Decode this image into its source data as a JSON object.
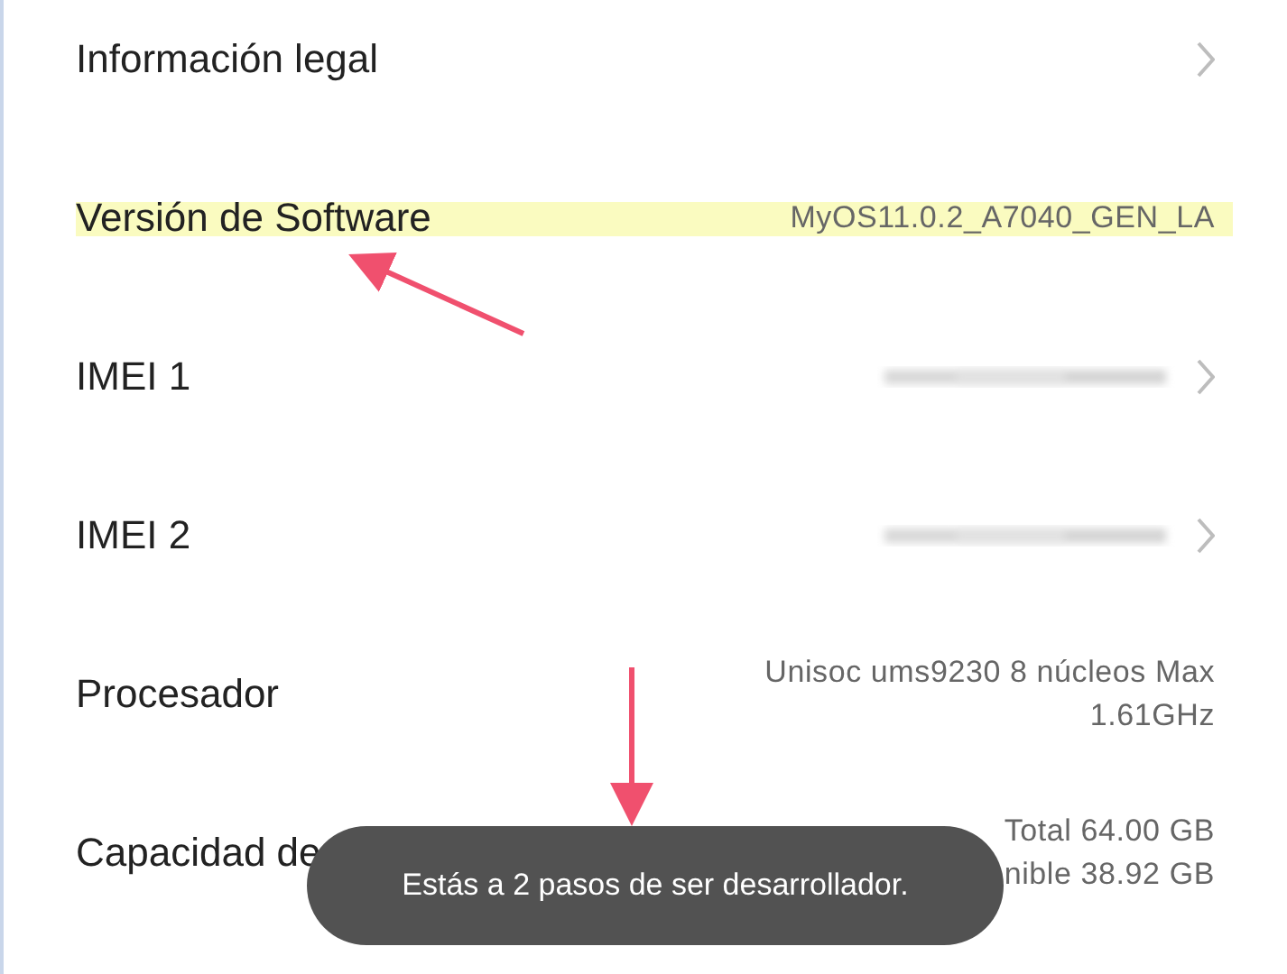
{
  "rows": [
    {
      "kind": "link",
      "label": "Información legal",
      "highlighted": false
    },
    {
      "kind": "value",
      "label": "Versión de Software",
      "values": [
        "MyOS11.0.2_A7040_GEN_LA"
      ],
      "highlighted": true
    },
    {
      "kind": "blurred_link",
      "label": "IMEI 1",
      "highlighted": false
    },
    {
      "kind": "blurred_link",
      "label": "IMEI 2",
      "highlighted": false
    },
    {
      "kind": "value",
      "label": "Procesador",
      "values": [
        "Unisoc ums9230 8 núcleos Max",
        "1.61GHz"
      ],
      "highlighted": false
    },
    {
      "kind": "value",
      "label": "Capacidad de",
      "values": [
        "Total 64.00 GB",
        "nible 38.92 GB"
      ],
      "highlighted": false
    }
  ],
  "toast": {
    "text": "Estás a 2 pasos de ser desarrollador."
  }
}
